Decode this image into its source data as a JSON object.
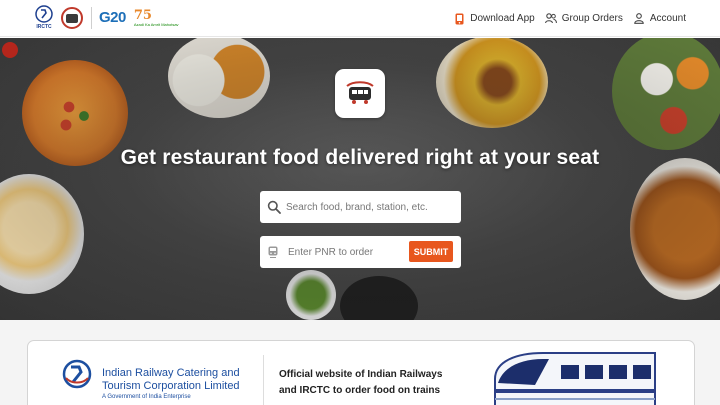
{
  "header": {
    "logos": {
      "irctc": "IRCTC",
      "g20": "G20",
      "azadi_number": "75",
      "azadi_text": "Azadi Ka Amrit Mahotsav"
    },
    "nav": [
      {
        "label": "Download App",
        "icon": "phone-icon"
      },
      {
        "label": "Group Orders",
        "icon": "group-icon"
      },
      {
        "label": "Account",
        "icon": "person-icon"
      }
    ]
  },
  "hero": {
    "title": "Get restaurant food delivered right at your seat",
    "search": {
      "placeholder": "Search food, brand, station, etc.",
      "value": ""
    },
    "pnr": {
      "placeholder": "Enter PNR to order",
      "value": ""
    },
    "submit_label": "SUBMIT",
    "icon": "ecatering-train-icon"
  },
  "info": {
    "org_name": "Indian Railway Catering and Tourism Corporation Limited",
    "org_sub": "A Government of India Enterprise",
    "logo_text": "IRCTC",
    "description": "Official website of Indian Railways and IRCTC to order food on trains"
  },
  "colors": {
    "accent": "#e8571e",
    "brand_blue": "#1d4fa0",
    "nav_icon": "#e8571e"
  }
}
